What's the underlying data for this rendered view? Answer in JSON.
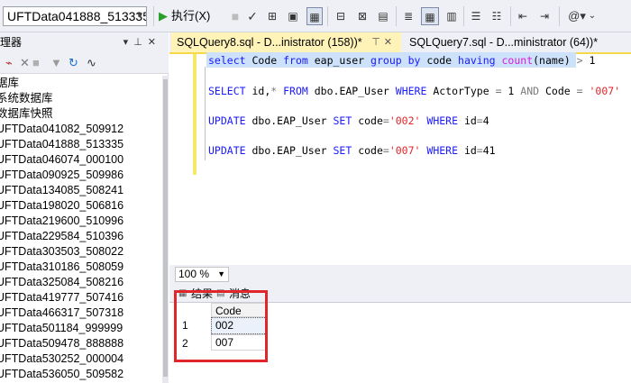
{
  "toolbar": {
    "database": "UFTData041888_513335",
    "execute_label": "执行(X)"
  },
  "explorer": {
    "title": "理器",
    "items": [
      "据库",
      "系统数据库",
      "数据库快照",
      "UFTData041082_509912",
      "UFTData041888_513335",
      "UFTData046074_000100",
      "UFTData090925_509986",
      "UFTData134085_508241",
      "UFTData198020_506816",
      "UFTData219600_510996",
      "UFTData229584_510396",
      "UFTData303503_508022",
      "UFTData310186_508059",
      "UFTData325084_508216",
      "UFTData419777_507416",
      "UFTData466317_507318",
      "UFTData501184_999999",
      "UFTData509478_888888",
      "UFTData530252_000004",
      "UFTData536050_509582"
    ]
  },
  "tabs": {
    "active": "SQLQuery8.sql - D...inistrator (158))*",
    "inactive": "SQLQuery7.sql - D...ministrator (64))*"
  },
  "editor": {
    "line1": {
      "k1": "select",
      "t1": " Code ",
      "k2": "from",
      "t2": " eap_user ",
      "k3": "group",
      "t3": " ",
      "k4": "by",
      "t4": " code ",
      "k5": "having",
      "t5": " ",
      "f1": "count",
      "t6": "(name) ",
      "g1": ">",
      "t7": " 1"
    },
    "line2": {
      "k1": "SELECT",
      "t1": " id,",
      "g1": "*",
      "t2": " ",
      "k2": "FROM",
      "t3": " dbo.EAP_User ",
      "k3": "WHERE",
      "t4": " ActorType ",
      "g2": "=",
      "t5": " 1 ",
      "g3": "AND",
      "t6": " Code ",
      "g4": "=",
      "t7": " ",
      "s1": "'007'"
    },
    "line3": {
      "k1": "UPDATE",
      "t1": " dbo.EAP_User ",
      "k2": "SET",
      "t2": " code",
      "g1": "=",
      "s1": "'002'",
      "t3": " ",
      "k3": "WHERE",
      "t4": " id",
      "g2": "=",
      "t5": "4"
    },
    "line4": {
      "k1": "UPDATE",
      "t1": " dbo.EAP_User ",
      "k2": "SET",
      "t2": " code",
      "g1": "=",
      "s1": "'007'",
      "t3": " ",
      "k3": "WHERE",
      "t4": " id",
      "g2": "=",
      "t5": "41"
    }
  },
  "zoom": "100 %",
  "result_tabs": {
    "results": "结果",
    "messages": "消息"
  },
  "grid": {
    "column": "Code",
    "rows": [
      {
        "num": "1",
        "value": "002"
      },
      {
        "num": "2",
        "value": "007"
      }
    ]
  },
  "colors": {
    "highlight": "#e0262a",
    "active_tab": "#fff3b8",
    "keyword": "#1a1aff",
    "string": "#e0262a"
  }
}
